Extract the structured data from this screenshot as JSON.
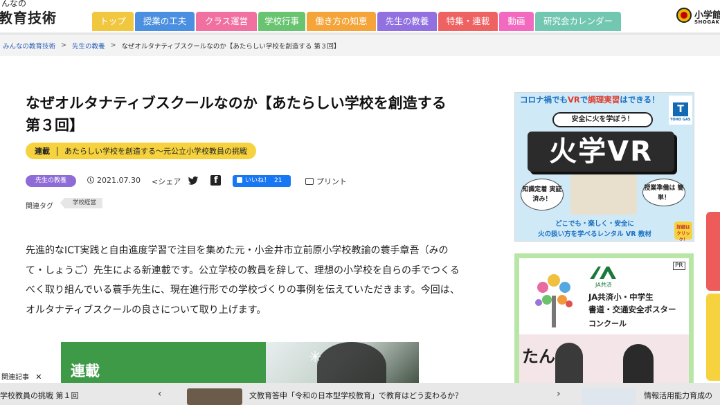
{
  "header": {
    "logo_small": "んなの",
    "logo_big": "教育技術",
    "publisher_name": "小学館",
    "publisher_romaji": "SHOGAKUKAN"
  },
  "nav": {
    "tabs": [
      {
        "label": "トップ",
        "color": "#f2c740"
      },
      {
        "label": "授業の工夫",
        "color": "#4a8fe0"
      },
      {
        "label": "クラス運営",
        "color": "#f070a0"
      },
      {
        "label": "学校行事",
        "color": "#68c470"
      },
      {
        "label": "働き方の知恵",
        "color": "#f5a43a"
      },
      {
        "label": "先生の教養",
        "color": "#9170e0"
      },
      {
        "label": "特集・連載",
        "color": "#ef6262"
      },
      {
        "label": "動画",
        "color": "#f26ac0"
      },
      {
        "label": "研究会カレンダー",
        "color": "#72c7b0"
      }
    ]
  },
  "breadcrumb": {
    "home": "みんなの教育技術",
    "category": "先生の教養",
    "current": "なぜオルタナティブスクールなのか【あたらしい学校を創造する 第３回】",
    "separator": ">"
  },
  "article": {
    "title": "なぜオルタナティブスクールなのか【あたらしい学校を創造する 第３回】",
    "series_label": "連載",
    "series_name": "あたらしい学校を創造する〜元公立小学校教員の挑戦",
    "category": "先生の教養",
    "date": "2021.07.30",
    "share_label": "シェア",
    "like_label": "いいね！",
    "like_count": "21",
    "print_label": "プリント",
    "tag_label": "関連タグ",
    "tags": [
      "学校経営"
    ],
    "lead": "先進的なICT実践と自由進度学習で注目を集めた元・小金井市立前原小学校教諭の蓑手章吾（みのて・しょうご）先生による新連載です。公立学校の教員を辞して、理想の小学校を自らの手でつくるべく取り組んでいる蓑手先生に、現在進行形での学校づくりの事例を伝えていただきます。今回は、オルタナティブスクールの良さについて取り上げます。",
    "hero_title": "連載"
  },
  "ad_top": {
    "head_prefix": "コロナ禍でも",
    "head_vr": "VR",
    "head_mid": "で",
    "head_cook": "調理実習",
    "head_suffix": "はできる！",
    "pill": "安全に火を学ぼう！",
    "big_text": "火学VR",
    "bubble_left": "知識定着 実証済み！",
    "bubble_right": "授業準備は 簡単！",
    "footer_1": "どこでも・楽しく・安全に",
    "footer_2": "火の扱い方を学べるレンタル VR 教材",
    "detail_button": "詳細は クリック！",
    "logo_letter": "T",
    "logo_sub": "TOHO GAS"
  },
  "ad_bottom": {
    "pr": "PR",
    "org": "JA共済",
    "line_1": "JA共済小・中学生",
    "line_2": "書道・交通安全ポスター",
    "line_3": "コンクール",
    "tan": "たん"
  },
  "floating": {
    "label": "関連記事",
    "close": "✕"
  },
  "recommend_bar": {
    "item_1": "学校教員の挑戦 第１回",
    "arrow_left": "‹",
    "item_2": "文教育答申「令和の日本型学校教育」で教育はどう変わるか？",
    "arrow_right": "›",
    "item_3": "情報活用能力育成の"
  },
  "colors": {
    "series_badge": "#f6d23f",
    "category_pill": "#8e6bd6",
    "link_blue": "#2d62b7",
    "facebook_blue": "#1877f2"
  }
}
